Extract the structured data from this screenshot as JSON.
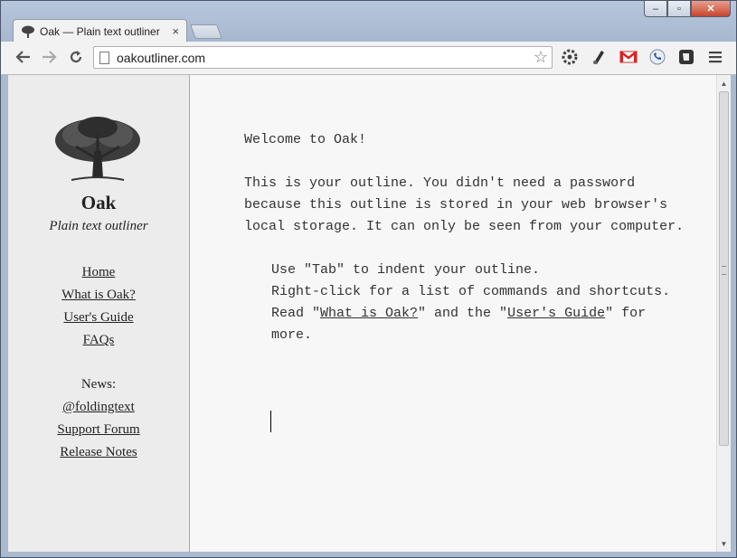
{
  "browser": {
    "tab_title": "Oak — Plain text outliner",
    "tab_close": "×",
    "url": "oakoutliner.com",
    "window_controls": {
      "minimize": "‒",
      "maximize": "▫",
      "close": "✕"
    }
  },
  "sidebar": {
    "brand": "Oak",
    "tagline": "Plain text outliner",
    "nav": [
      "Home",
      "What is Oak?",
      "User's Guide",
      "FAQs"
    ],
    "news_label": "News:",
    "news_links": [
      "@foldingtext",
      "Support Forum",
      "Release Notes"
    ]
  },
  "outline": {
    "welcome": "Welcome to Oak!",
    "intro": "This is your outline. You didn't need a password because this outline is stored in your web browser's local storage. It can only be seen from your computer.",
    "tab_tip": "Use \"Tab\" to indent your outline.",
    "rightclick_tip": "Right-click for a list of commands and shortcuts.",
    "read_prefix": "Read \"",
    "read_link1": "What is Oak?",
    "read_mid": "\" and the \"",
    "read_link2": "User's Guide",
    "read_suffix": "\" for more."
  },
  "icons": [
    "back-icon",
    "forward-icon",
    "reload-icon",
    "page-icon",
    "star-icon",
    "extension-icon",
    "pen-icon",
    "gmail-icon",
    "phone-icon",
    "evernote-icon",
    "menu-icon",
    "oak-tree-logo"
  ]
}
